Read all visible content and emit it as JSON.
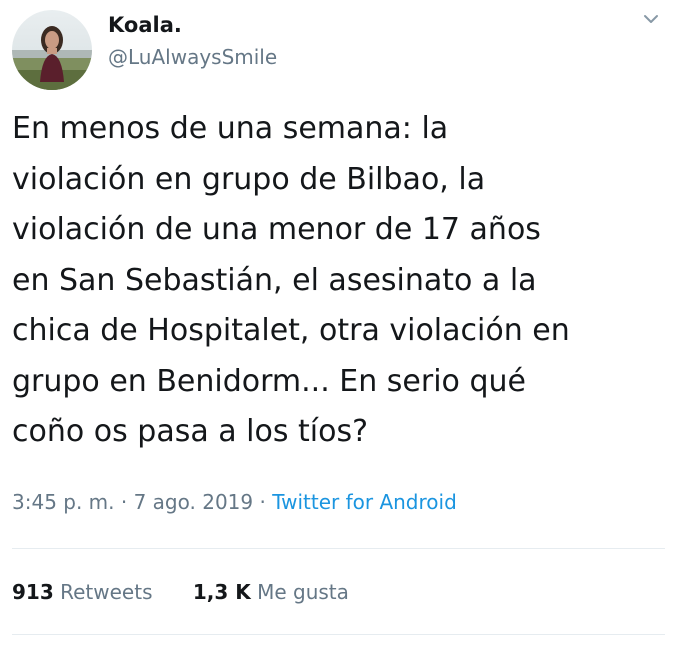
{
  "author": {
    "display_name": "Koala.",
    "handle": "@LuAlwaysSmile"
  },
  "tweet": {
    "lines": [
      "En menos de una semana: la",
      "violación en grupo de Bilbao, la",
      "violación de una menor de 17 años",
      "en San Sebastián, el asesinato a la",
      "chica de Hospitalet, otra violación en",
      "grupo en Benidorm... En serio qué",
      "coño os pasa a los tíos?"
    ]
  },
  "meta": {
    "timestamp": "3:45 p. m. · 7 ago. 2019",
    "separator": " · ",
    "source": "Twitter for Android"
  },
  "stats": {
    "retweets_count": "913",
    "retweets_label": "Retweets",
    "likes_count": "1,3 K",
    "likes_label": "Me gusta"
  },
  "icons": {
    "menu": "chevron-down-icon",
    "avatar": "avatar"
  },
  "colors": {
    "text": "#14171a",
    "secondary": "#657786",
    "link": "#1b95e0",
    "divider": "#e6ecf0"
  }
}
